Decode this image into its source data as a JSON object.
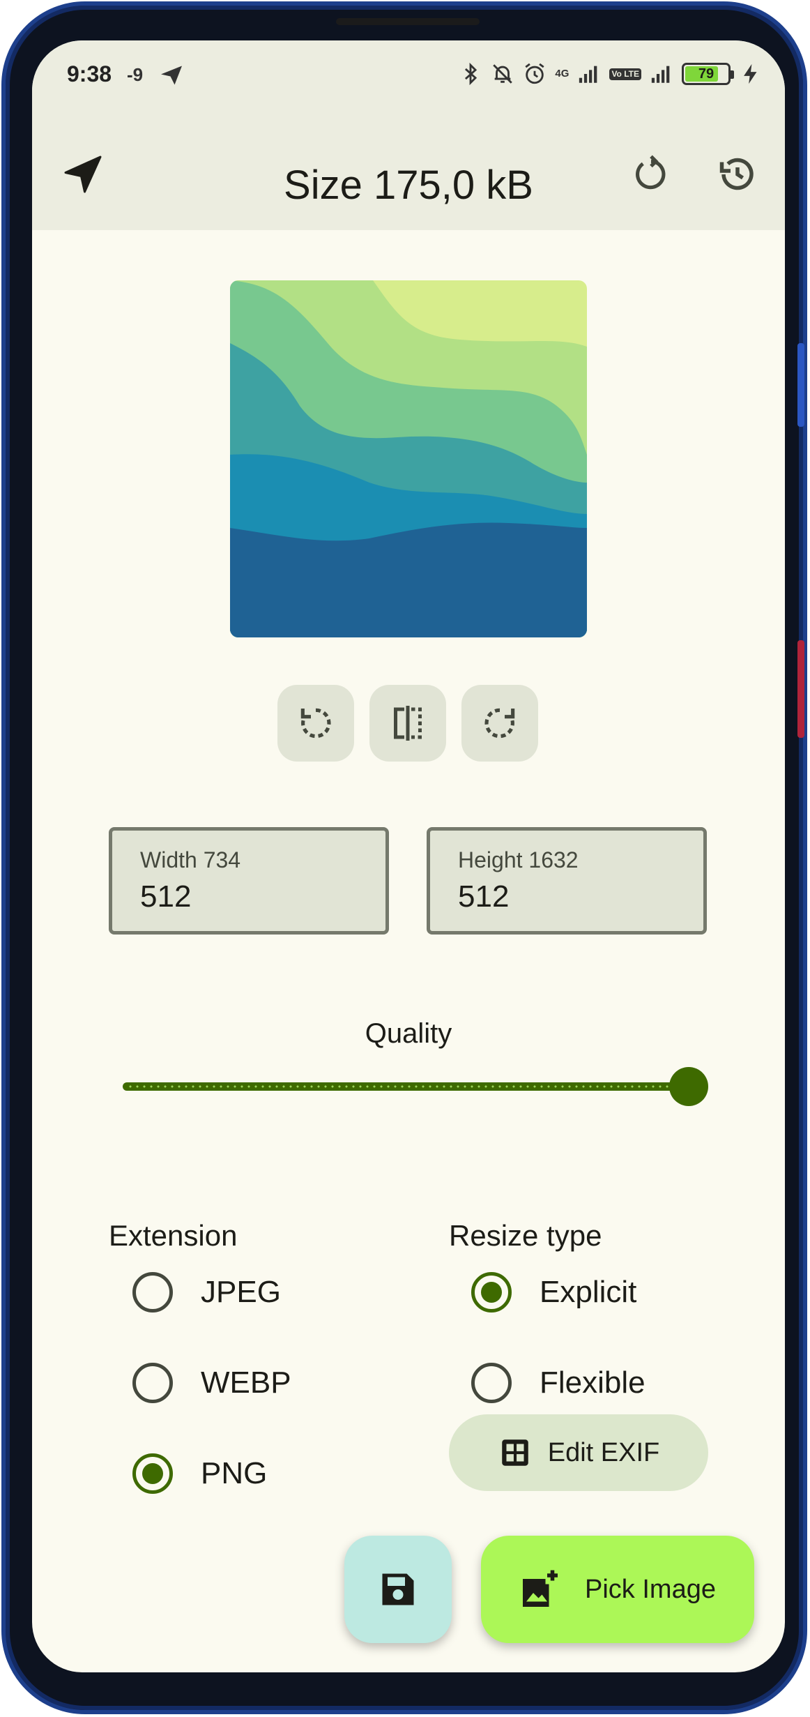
{
  "status_bar": {
    "time": "9:38",
    "extra": "-9",
    "network": "4G",
    "volte": "Vo LTE",
    "battery": "79",
    "battery_level": 0.79
  },
  "app_bar": {
    "title": "Size 175,0 kB",
    "icons": [
      "send-icon",
      "reset-icon",
      "history-icon"
    ]
  },
  "image_tools": [
    "rotate-left-icon",
    "flip-icon",
    "rotate-right-icon"
  ],
  "dimensions": {
    "width_label": "Width 734",
    "width_value": "512",
    "height_label": "Height 1632",
    "height_value": "512"
  },
  "quality": {
    "label": "Quality",
    "value": 1.0
  },
  "extension": {
    "title": "Extension",
    "options": [
      {
        "label": "JPEG",
        "selected": false
      },
      {
        "label": "WEBP",
        "selected": false
      },
      {
        "label": "PNG",
        "selected": true
      }
    ]
  },
  "resize_type": {
    "title": "Resize type",
    "options": [
      {
        "label": "Explicit",
        "selected": true
      },
      {
        "label": "Flexible",
        "selected": false
      }
    ]
  },
  "exif_button": {
    "label": "Edit EXIF"
  },
  "fabs": {
    "save_icon": "save-icon",
    "pick_label": "Pick Image"
  },
  "colors": {
    "primary": "#3e6a00",
    "surface": "#fbfaf0",
    "top_bar": "#ecede0",
    "pick_fab": "#acf757",
    "save_fab": "#bde9e1"
  }
}
